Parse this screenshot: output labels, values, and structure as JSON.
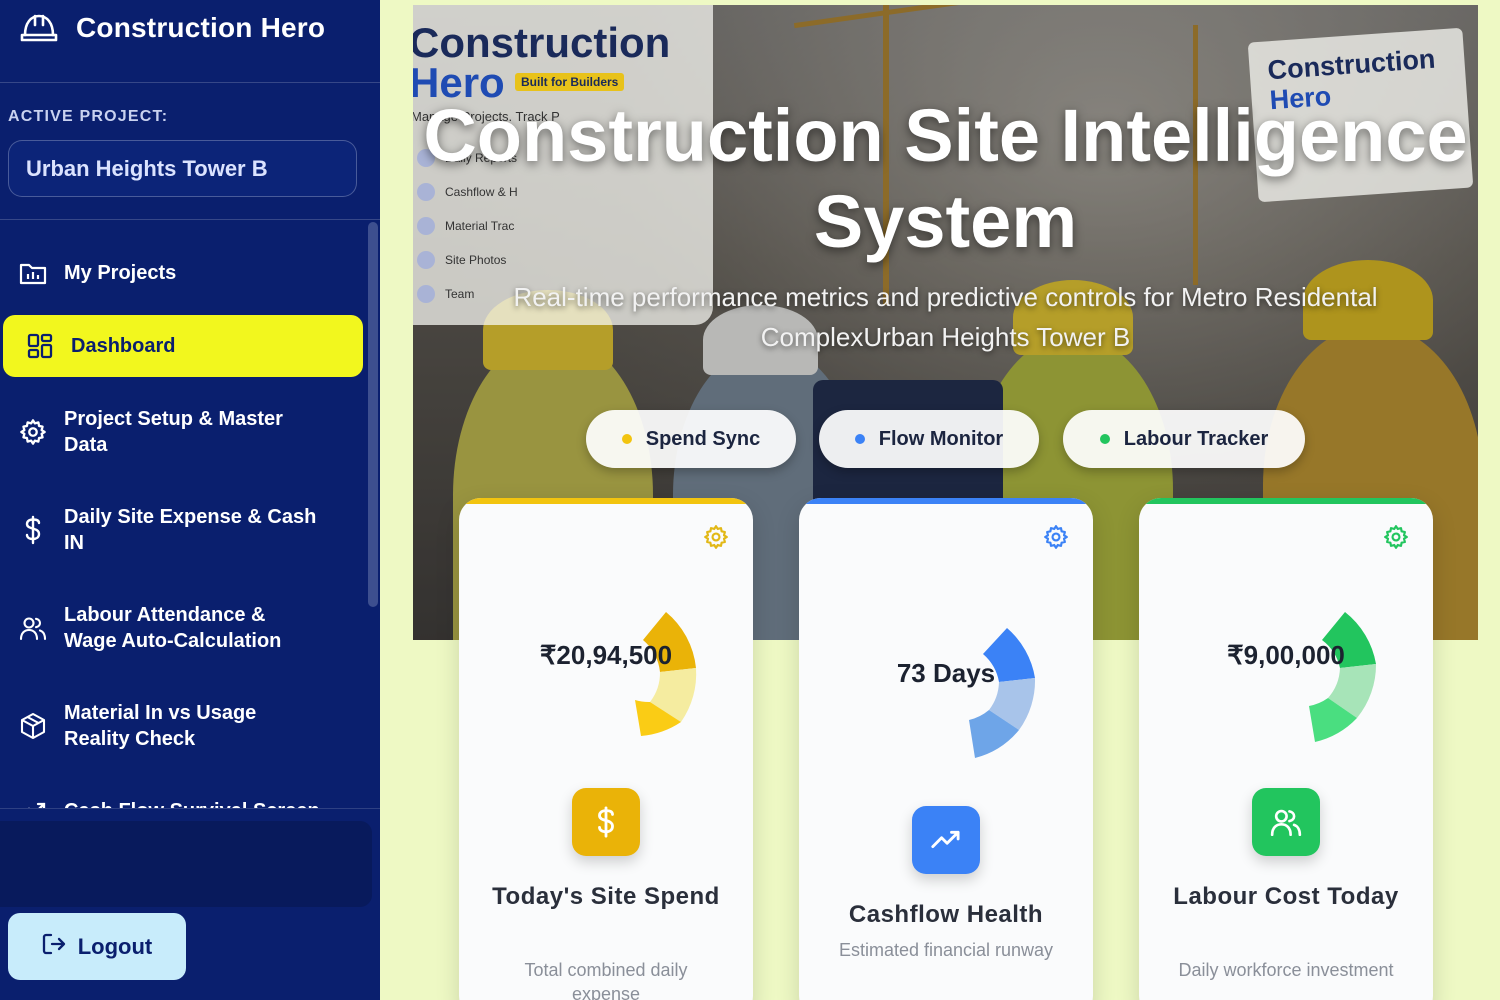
{
  "app": {
    "title": "Construction Hero"
  },
  "sidebar": {
    "section_label": "ACTIVE PROJECT:",
    "active_project": "Urban Heights Tower B",
    "items": [
      {
        "label": "My Projects",
        "icon": "folder-chart-icon"
      },
      {
        "label": "Dashboard",
        "icon": "dashboard-grid-icon",
        "active": true
      },
      {
        "label": "Project Setup & Master Data",
        "icon": "gear-icon"
      },
      {
        "label": "Daily Site Expense & Cash IN",
        "icon": "dollar-icon"
      },
      {
        "label": "Labour Attendance & Wage Auto-Calculation",
        "icon": "users-icon"
      },
      {
        "label": "Material In vs Usage Reality Check",
        "icon": "box-icon"
      },
      {
        "label": "Cash Flow Survival Screen",
        "icon": "trend-icon"
      }
    ],
    "logout_label": "Logout"
  },
  "hero": {
    "title": "Construction Site Intelligence System",
    "subtitle": "Real-time performance metrics and predictive controls for Metro Residental ComplexUrban Heights Tower B",
    "background_logo": {
      "line1": "Construction",
      "line2": "Hero",
      "tag": "Built for Builders",
      "tagline": "Manage Projects. Track P",
      "menu": [
        "Daily Reports",
        "Cashflow & H",
        "Material Trac",
        "Site Photos",
        "Team"
      ]
    },
    "sign": {
      "line1": "Construction",
      "line2": "Hero"
    },
    "pills": [
      {
        "label": "Spend Sync",
        "color": "#f2c40f"
      },
      {
        "label": "Flow Monitor",
        "color": "#3b82f6"
      },
      {
        "label": "Labour Tracker",
        "color": "#22c55e"
      }
    ]
  },
  "cards": [
    {
      "value": "₹20,94,500",
      "title": "Today's Site Spend",
      "description": "Total combined daily expense",
      "accent": "#f2c40f",
      "icon": "dollar-icon"
    },
    {
      "value": "73 Days",
      "title": "Cashflow Health",
      "description": "Estimated financial runway",
      "accent": "#3b82f6",
      "icon": "trending-up-icon"
    },
    {
      "value": "₹9,00,000",
      "title": "Labour Cost Today",
      "description": "Daily workforce investment",
      "accent": "#22c55e",
      "icon": "users-icon"
    }
  ]
}
